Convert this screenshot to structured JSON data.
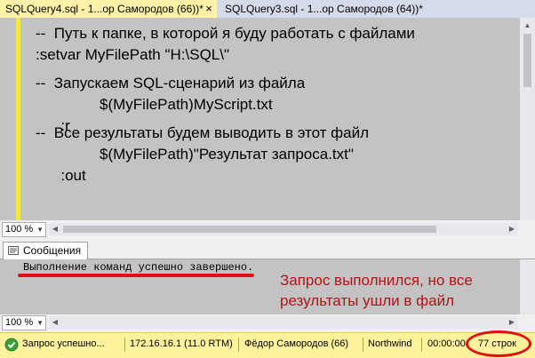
{
  "tabs": [
    {
      "label": "SQLQuery4.sql - 1...ор Самородов (66))*",
      "close": "×"
    },
    {
      "label": "SQLQuery3.sql - 1...ор Самородов (64))*"
    }
  ],
  "editor": {
    "lines": [
      "--  Путь к папке, в которой я буду работать с файлами",
      ":setvar MyFilePath \"H:\\SQL\\\"",
      "--  Запускаем SQL-сценарий из файла",
      {
        "cmd": ":r",
        "arg": "$(MyFilePath)MyScript.txt"
      },
      "--  Все результаты будем выводить в этот файл",
      {
        "cmd": ":out",
        "arg": "$(MyFilePath)\"Результат запроса.txt\""
      }
    ]
  },
  "zoom": {
    "editor": "100 %",
    "messages": "100 %"
  },
  "results": {
    "tab_label": "Сообщения",
    "message": "Выполнение команд успешно завершено.",
    "annotation": "Запрос выполнился, но все результаты ушли в файл"
  },
  "status": {
    "state": "Запрос успешно...",
    "server": "172.16.16.1 (11.0 RTM)",
    "user": "Фёдор Самородов (66)",
    "database": "Northwind",
    "time": "00:00:00",
    "rows": "77 строк"
  },
  "colors": {
    "tab_active": "#fff1a8",
    "editor_bg": "#c3c3c3",
    "change_bar": "#f6e347",
    "annotation": "#b31217",
    "highlight": "#e01010",
    "status_bar": "#fff29d"
  },
  "icons": {
    "messages_tab": "message-icon",
    "status_ok": "check-circle-icon"
  }
}
